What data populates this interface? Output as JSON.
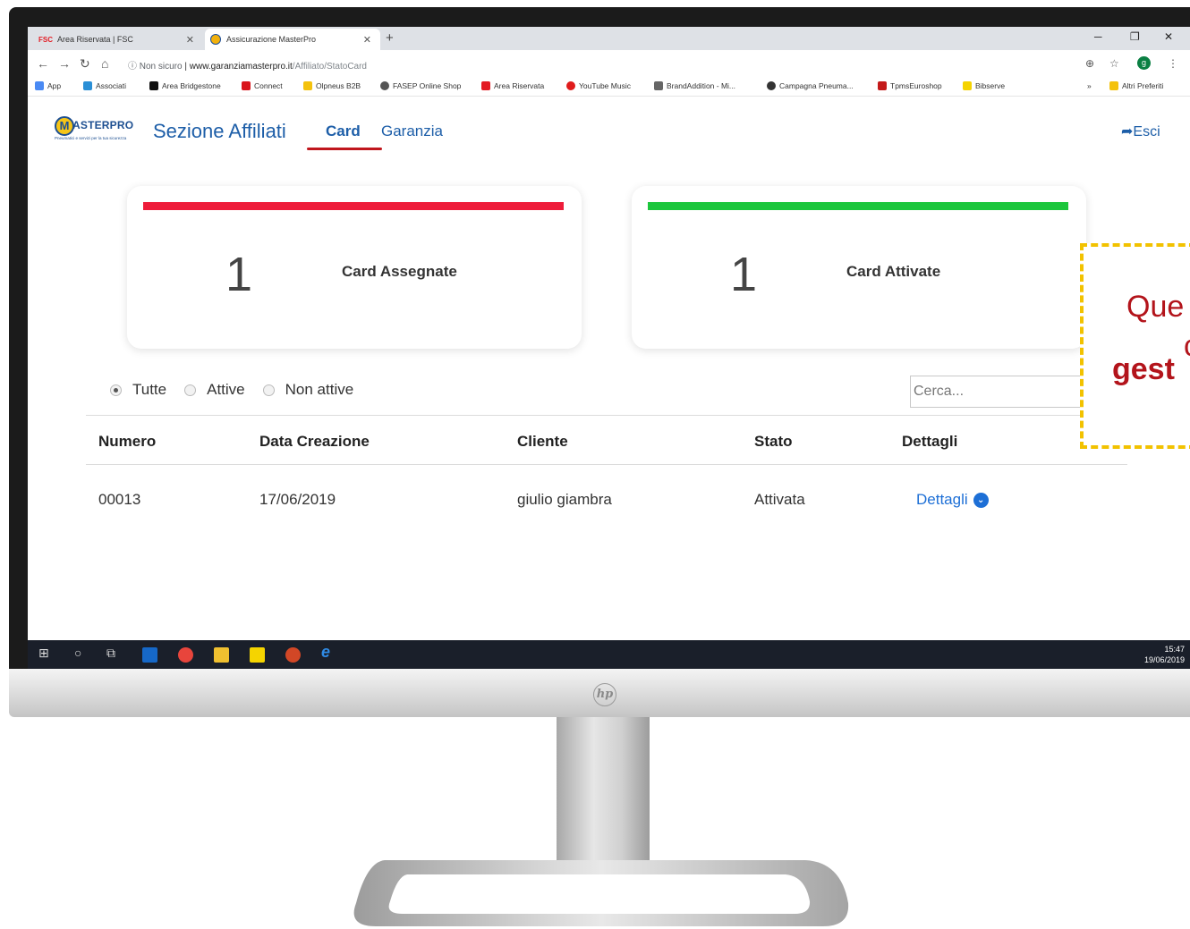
{
  "browser": {
    "tabs": [
      {
        "favicon": "FSC",
        "title": "Area Riservata | FSC",
        "active": false
      },
      {
        "favicon": "masterpro-icon",
        "title": "Assicurazione MasterPro",
        "active": true
      }
    ],
    "new_tab": "+",
    "address": {
      "security": "ⓘ Non sicuro",
      "separator": "|",
      "host": "www.garanziamasterpro.it",
      "path": "/Affiliato/StatoCard"
    },
    "profile_initial": "g",
    "bookmarks": [
      {
        "label": "App",
        "icon": "apps-grid-icon"
      },
      {
        "label": "Associati",
        "icon": "associati-icon"
      },
      {
        "label": "Area Bridgestone",
        "icon": "bridgestone-icon"
      },
      {
        "label": "Connect",
        "icon": "firestone-icon"
      },
      {
        "label": "Olpneus B2B",
        "icon": "olpneus-icon"
      },
      {
        "label": "FASEP Online Shop",
        "icon": "fasep-icon"
      },
      {
        "label": "Area Riservata",
        "icon": "fsc-icon"
      },
      {
        "label": "YouTube Music",
        "icon": "youtube-music-icon"
      },
      {
        "label": "BrandAddition - Mi...",
        "icon": "brandaddition-icon"
      },
      {
        "label": "Campagna Pneuma...",
        "icon": "campagna-icon"
      },
      {
        "label": "TpmsEuroshop",
        "icon": "tpms-icon"
      },
      {
        "label": "Bibserve",
        "icon": "bibserve-icon"
      }
    ],
    "more_bookmarks": "»",
    "other_bookmarks": "Altri Preferiti"
  },
  "page": {
    "logo": {
      "m": "M",
      "text": "ASTERPRO",
      "tagline": "Pneumatici e servizi per la tua sicurezza"
    },
    "section_title": "Sezione Affiliati",
    "nav": [
      {
        "label": "Card",
        "active": true
      },
      {
        "label": "Garanzia",
        "active": false
      }
    ],
    "logout": "Esci",
    "stats": [
      {
        "value": "1",
        "label": "Card Assegnate",
        "color": "#ee1c3a"
      },
      {
        "value": "1",
        "label": "Card Attivate",
        "color": "#1cc63c"
      }
    ],
    "filters": [
      {
        "label": "Tutte",
        "checked": true
      },
      {
        "label": "Attive",
        "checked": false
      },
      {
        "label": "Non attive",
        "checked": false
      }
    ],
    "search_placeholder": "Cerca...",
    "table": {
      "headers": [
        "Numero",
        "Data Creazione",
        "Cliente",
        "Stato",
        "Dettagli"
      ],
      "rows": [
        {
          "numero": "00013",
          "data": "17/06/2019",
          "cliente": "giulio giambra",
          "stato": "Attivata",
          "dettagli": "Dettagli"
        }
      ]
    }
  },
  "taskbar": {
    "time": "15:47",
    "date": "19/06/2019"
  },
  "callout": {
    "line1": "Que",
    "line2": "c",
    "line3": "gest",
    "border_color": "#f2c200",
    "text_color": "#b3141b"
  }
}
